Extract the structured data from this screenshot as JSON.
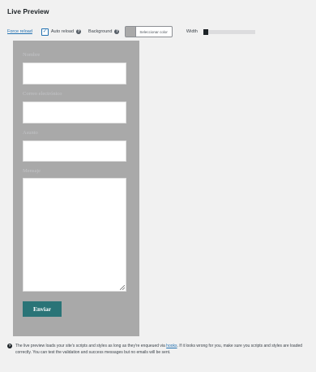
{
  "panel": {
    "title": "Live Preview"
  },
  "toolbar": {
    "force_reload": "Force reload",
    "auto_reload_label": "Auto reload",
    "auto_reload_checked": true,
    "background_label": "Background",
    "background_color": "#a9a9a9",
    "select_color_label": "Seleccionar color",
    "width_label": "Width"
  },
  "form": {
    "fields": [
      {
        "label": "Nombre"
      },
      {
        "label": "Correo electrónico"
      },
      {
        "label": "Asunto"
      },
      {
        "label": "Mensaje"
      }
    ],
    "submit_label": "Enviar",
    "submit_color": "#2a7477"
  },
  "info": {
    "text_before_link": "The live preview loads your site's scripts and styles as long as they're enqueued via ",
    "link_text": "hooks",
    "text_after_link": ". If it looks wrong for you, make sure you scripts and styles are loaded correctly. You can test the validation and success messages but no emails will be sent."
  }
}
